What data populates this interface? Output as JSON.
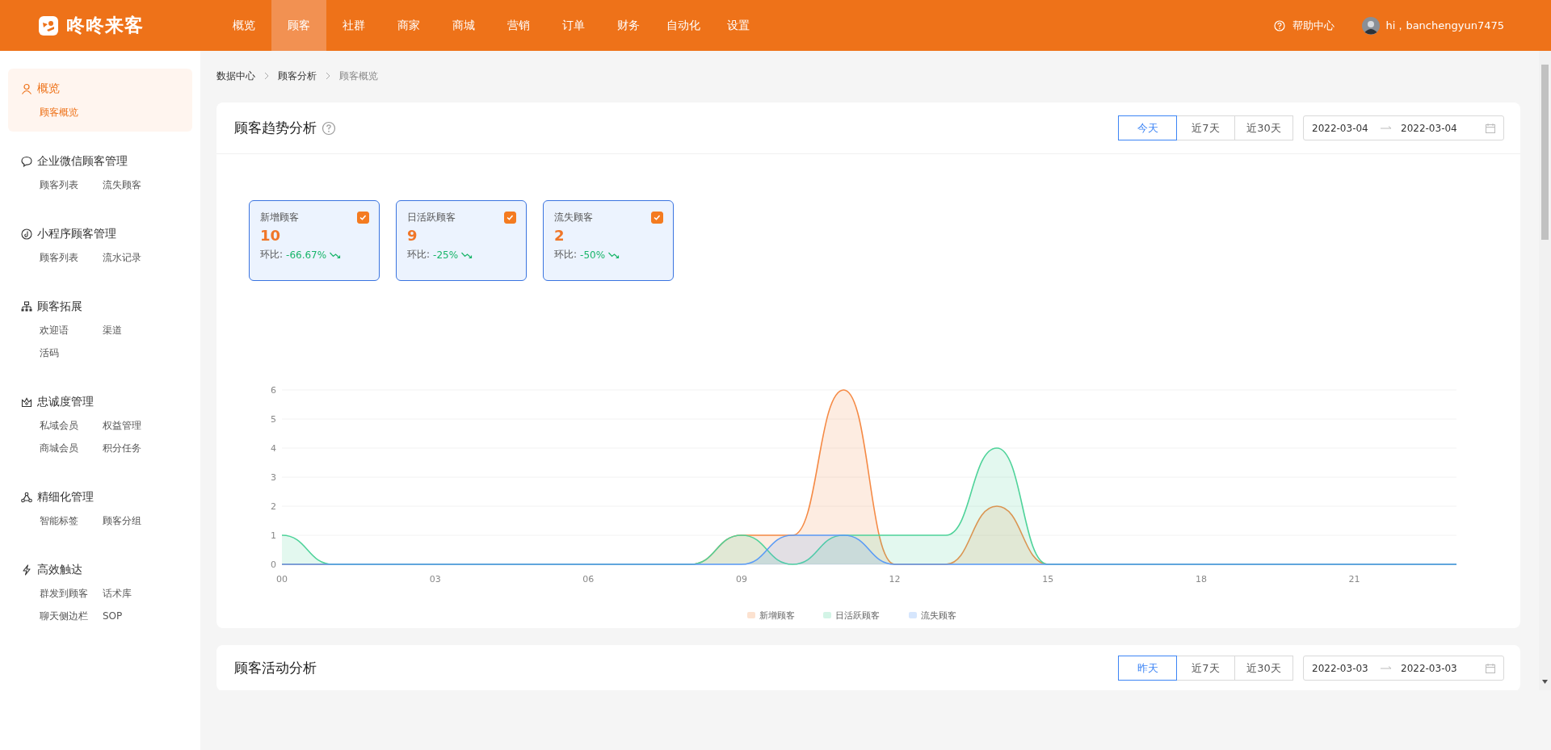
{
  "header": {
    "brand": "咚咚来客",
    "nav": [
      {
        "label": "概览",
        "selected": false
      },
      {
        "label": "顾客",
        "selected": true
      },
      {
        "label": "社群",
        "selected": false
      },
      {
        "label": "商家",
        "selected": false
      },
      {
        "label": "商城",
        "selected": false
      },
      {
        "label": "营销",
        "selected": false
      },
      {
        "label": "订单",
        "selected": false
      },
      {
        "label": "财务",
        "selected": false
      },
      {
        "label": "自动化",
        "selected": false
      },
      {
        "label": "设置",
        "selected": false
      }
    ],
    "help": "帮助中心",
    "user": "hi，banchengyun7475"
  },
  "sidebar": {
    "groups": [
      {
        "title": "概览",
        "selected": true,
        "items": [
          {
            "label": "顾客概览",
            "selected": true
          }
        ]
      },
      {
        "title": "企业微信顾客管理",
        "selected": false,
        "items": [
          {
            "label": "顾客列表",
            "selected": false
          },
          {
            "label": "流失顾客",
            "selected": false
          }
        ]
      },
      {
        "title": "小程序顾客管理",
        "selected": false,
        "items": [
          {
            "label": "顾客列表",
            "selected": false
          },
          {
            "label": "流水记录",
            "selected": false
          }
        ]
      },
      {
        "title": "顾客拓展",
        "selected": false,
        "items": [
          {
            "label": "欢迎语",
            "selected": false
          },
          {
            "label": "渠道",
            "selected": false
          },
          {
            "label": "活码",
            "selected": false
          }
        ]
      },
      {
        "title": "忠诚度管理",
        "selected": false,
        "items": [
          {
            "label": "私域会员",
            "selected": false
          },
          {
            "label": "权益管理",
            "selected": false
          },
          {
            "label": "商城会员",
            "selected": false
          },
          {
            "label": "积分任务",
            "selected": false
          }
        ]
      },
      {
        "title": "精细化管理",
        "selected": false,
        "items": [
          {
            "label": "智能标签",
            "selected": false
          },
          {
            "label": "顾客分组",
            "selected": false
          }
        ]
      },
      {
        "title": "高效触达",
        "selected": false,
        "items": [
          {
            "label": "群发到顾客",
            "selected": false
          },
          {
            "label": "话术库",
            "selected": false
          },
          {
            "label": "聊天侧边栏",
            "selected": false
          },
          {
            "label": "SOP",
            "selected": false
          }
        ]
      }
    ]
  },
  "breadcrumb": [
    {
      "label": "数据中心",
      "current": false
    },
    {
      "label": "顾客分析",
      "current": false
    },
    {
      "label": "顾客概览",
      "current": true
    }
  ],
  "sections": [
    {
      "title": "顾客趋势分析",
      "has_help": true,
      "ranges": [
        {
          "label": "今天",
          "selected": true
        },
        {
          "label": "近7天",
          "selected": false
        },
        {
          "label": "近30天",
          "selected": false
        }
      ],
      "date_from": "2022-03-04",
      "date_to": "2022-03-04",
      "metrics": [
        {
          "label": "新增顾客",
          "value": "10",
          "checked": true,
          "compare_label": "环比:",
          "change": "-66.67%"
        },
        {
          "label": "日活跃顾客",
          "value": "9",
          "checked": true,
          "compare_label": "环比:",
          "change": "-25%"
        },
        {
          "label": "流失顾客",
          "value": "2",
          "checked": true,
          "compare_label": "环比:",
          "change": "-50%"
        }
      ],
      "chart_data": {
        "type": "area",
        "x": [
          0,
          1,
          2,
          3,
          4,
          5,
          6,
          7,
          8,
          9,
          10,
          11,
          12,
          13,
          14,
          15,
          16,
          17,
          18,
          19,
          20,
          21,
          22,
          23
        ],
        "xlim": [
          0,
          23
        ],
        "ylim": [
          0,
          6
        ],
        "grid": true,
        "legend": "bottom",
        "xticks": [
          {
            "value": 0,
            "label": "00"
          },
          {
            "value": 3,
            "label": "03"
          },
          {
            "value": 6,
            "label": "06"
          },
          {
            "value": 9,
            "label": "09"
          },
          {
            "value": 12,
            "label": "12"
          },
          {
            "value": 15,
            "label": "15"
          },
          {
            "value": 18,
            "label": "18"
          },
          {
            "value": 21,
            "label": "21"
          }
        ],
        "yticks": [
          0,
          1,
          2,
          3,
          4,
          5,
          6
        ],
        "series": [
          {
            "name": "新增顾客",
            "color": "#f58a45",
            "values": [
              0,
              0,
              0,
              0,
              0,
              0,
              0,
              0,
              0,
              1,
              1,
              6,
              0,
              0,
              2,
              0,
              0,
              0,
              0,
              0,
              0,
              0,
              0,
              0
            ]
          },
          {
            "name": "日活跃顾客",
            "color": "#4fd39a",
            "values": [
              1,
              0,
              0,
              0,
              0,
              0,
              0,
              0,
              0,
              1,
              0,
              1,
              1,
              1,
              4,
              0,
              0,
              0,
              0,
              0,
              0,
              0,
              0,
              0
            ]
          },
          {
            "name": "流失顾客",
            "color": "#5a9bf6",
            "values": [
              0,
              0,
              0,
              0,
              0,
              0,
              0,
              0,
              0,
              0,
              1,
              1,
              0,
              0,
              0,
              0,
              0,
              0,
              0,
              0,
              0,
              0,
              0,
              0
            ]
          }
        ]
      }
    },
    {
      "title": "顾客活动分析",
      "has_help": false,
      "ranges": [
        {
          "label": "昨天",
          "selected": true
        },
        {
          "label": "近7天",
          "selected": false
        },
        {
          "label": "近30天",
          "selected": false
        }
      ],
      "date_from": "2022-03-03",
      "date_to": "2022-03-03"
    }
  ]
}
